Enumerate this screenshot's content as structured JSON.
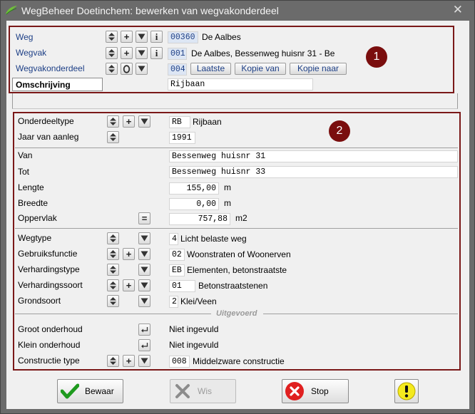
{
  "window": {
    "title": "WegBeheer Doetinchem: bewerken van wegvakonderdeel",
    "close": "✕"
  },
  "top": {
    "weg": {
      "label": "Weg",
      "code": "00360",
      "value": "De Aalbes"
    },
    "wegvak": {
      "label": "Wegvak",
      "code": "001",
      "value": "De Aalbes, Bessenweg huisnr 31 - Be"
    },
    "wegvakonderdeel": {
      "label": "Wegvakonderdeel",
      "code": "004",
      "laatste": "Laatste",
      "kopie_van": "Kopie van",
      "kopie_naar": "Kopie naar"
    },
    "omschrijving": {
      "label": "Omschrijving",
      "value": "Rijbaan"
    },
    "badge": "1"
  },
  "main": {
    "badge": "2",
    "onderdeeltype": {
      "label": "Onderdeeltype",
      "code": "RB",
      "value": "Rijbaan"
    },
    "jaar": {
      "label": "Jaar van aanleg",
      "value": "1991"
    },
    "van": {
      "label": "Van",
      "value": "Bessenweg huisnr 31"
    },
    "tot": {
      "label": "Tot",
      "value": "Bessenweg huisnr 33"
    },
    "lengte": {
      "label": "Lengte",
      "value": "155,00",
      "unit": "m"
    },
    "breedte": {
      "label": "Breedte",
      "value": "0,00",
      "unit": "m"
    },
    "oppervlak": {
      "label": "Oppervlak",
      "value": "757,88",
      "unit": "m2"
    },
    "wegtype": {
      "label": "Wegtype",
      "code": "4",
      "value": "Licht belaste weg"
    },
    "gebruiksfunctie": {
      "label": "Gebruiksfunctie",
      "code": "02",
      "value": "Woonstraten of Woonerven"
    },
    "verhardingstype": {
      "label": "Verhardingstype",
      "code": "EB",
      "value": "Elementen, betonstraatste"
    },
    "verhardingssoort": {
      "label": "Verhardingssoort",
      "code": "01",
      "value": "Betonstraatstenen"
    },
    "grondsoort": {
      "label": "Grondsoort",
      "code": "2",
      "value": "Klei/Veen"
    },
    "uitgevoerd": "Uitgevoerd",
    "groot": {
      "label": "Groot onderhoud",
      "value": "Niet ingevuld"
    },
    "klein": {
      "label": "Klein onderhoud",
      "value": "Niet ingevuld"
    },
    "constructie": {
      "label": "Constructie type",
      "code": "008",
      "value": "Middelzware constructie"
    }
  },
  "buttons": {
    "bewaar": "Bewaar",
    "wis": "Wis",
    "stop": "Stop"
  },
  "colors": {
    "panel_border": "#7a1818",
    "badge": "#7a0e0e",
    "link_blue": "#1d3f86",
    "bewaar_green": "#1e9a1e",
    "stop_red": "#e02020",
    "warn_yellow": "#f4ea1e"
  },
  "icons": {
    "spin": "up-down-icon",
    "plus": "plus-icon",
    "down": "triangle-down-icon",
    "info": "info-icon",
    "circle": "zero-icon",
    "equals": "equals-icon",
    "enter": "return-icon"
  }
}
